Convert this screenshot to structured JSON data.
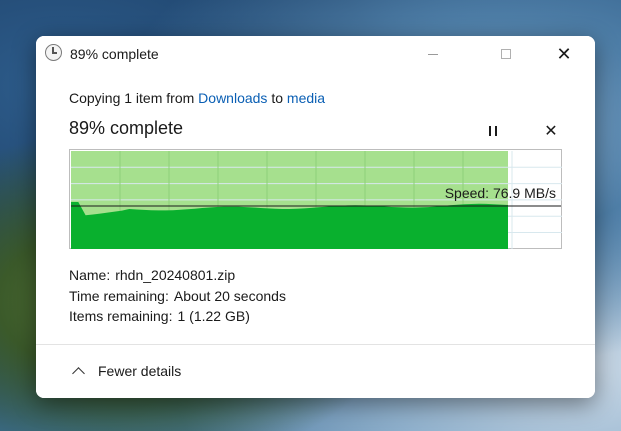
{
  "window": {
    "title": "89% complete"
  },
  "copy": {
    "prefix": "Copying 1 item from",
    "source": "Downloads",
    "connector": "to",
    "destination": "media"
  },
  "progress": {
    "heading": "89% complete",
    "percent": 89,
    "speed_label": "Speed: 76.9 MB/s"
  },
  "details": {
    "name_label": "Name:",
    "name_value": "rhdn_20240801.zip",
    "time_label": "Time remaining:",
    "time_value": "About 20 seconds",
    "items_label": "Items remaining:",
    "items_value": "1 (1.22 GB)"
  },
  "footer": {
    "toggle_label": "Fewer details"
  },
  "icons": {
    "title": "clock-icon",
    "pause": "pause-icon",
    "cancel": "close-icon",
    "toggle": "chevron-up-icon"
  },
  "colors": {
    "progress_fill": "#a6e08e",
    "speed_fill": "#09b02e",
    "link": "#0a5fb4"
  }
}
